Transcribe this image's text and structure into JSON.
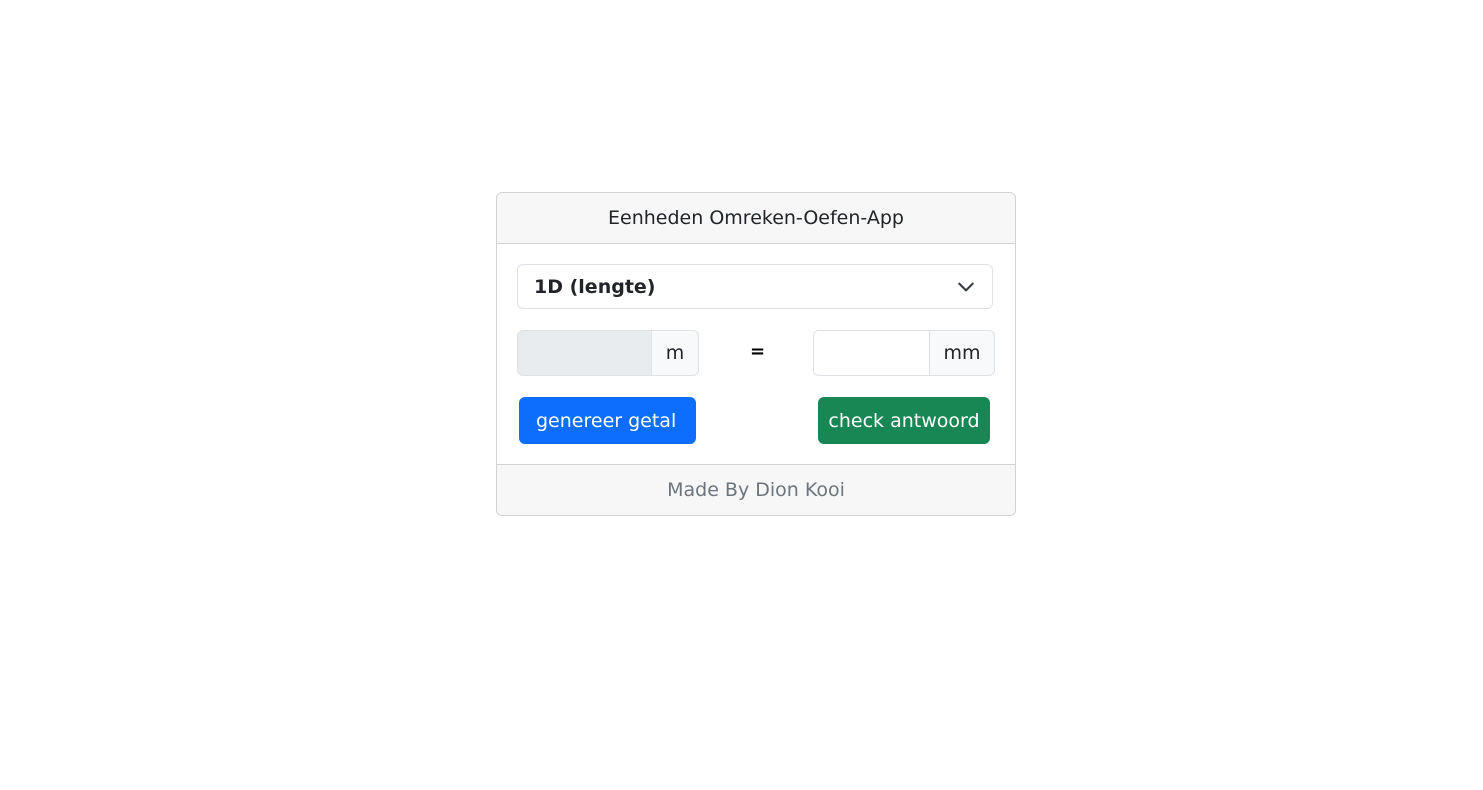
{
  "app": {
    "title": "Eenheden Omreken-Oefen-App"
  },
  "dimension_select": {
    "selected": "1D (lengte)",
    "icon": "chevron-down-icon"
  },
  "conversion": {
    "from_value": "",
    "from_unit": "m",
    "equals_sign": "=",
    "answer_value": "",
    "to_unit": "mm"
  },
  "buttons": {
    "generate_label": "genereer getal",
    "check_label": "check antwoord"
  },
  "footer": {
    "credit": "Made By Dion Kooi"
  },
  "colors": {
    "primary": "#0d6efd",
    "success": "#198754",
    "readonly_bg": "#e9ecef"
  }
}
